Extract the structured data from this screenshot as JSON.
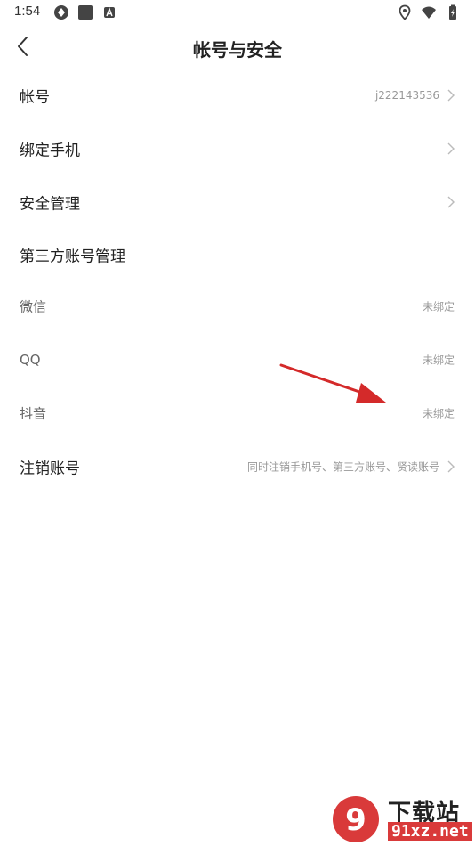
{
  "status_bar": {
    "time": "1:54",
    "left_icons": [
      "gesture-icon",
      "square-app-icon",
      "font-app-icon"
    ],
    "right_icons": [
      "location-icon",
      "wifi-icon",
      "battery-charging-icon"
    ]
  },
  "header": {
    "title": "帐号与安全"
  },
  "rows": {
    "account": {
      "label": "帐号",
      "value": "j222143536"
    },
    "bind_phone": {
      "label": "绑定手机"
    },
    "security": {
      "label": "安全管理"
    },
    "third_party": {
      "label": "第三方账号管理"
    },
    "wechat": {
      "label": "微信",
      "value": "未绑定"
    },
    "qq": {
      "label": "QQ",
      "value": "未绑定"
    },
    "douyin": {
      "label": "抖音",
      "value": "未绑定"
    },
    "cancel_account": {
      "label": "注销账号",
      "value": "同时注销手机号、第三方账号、贤读账号"
    }
  },
  "colors": {
    "annotation_arrow": "#d42a2a",
    "watermark_red": "#d93a3a"
  },
  "watermark": {
    "text": "下载站",
    "site": "91xz.net",
    "logo_text": "9"
  }
}
